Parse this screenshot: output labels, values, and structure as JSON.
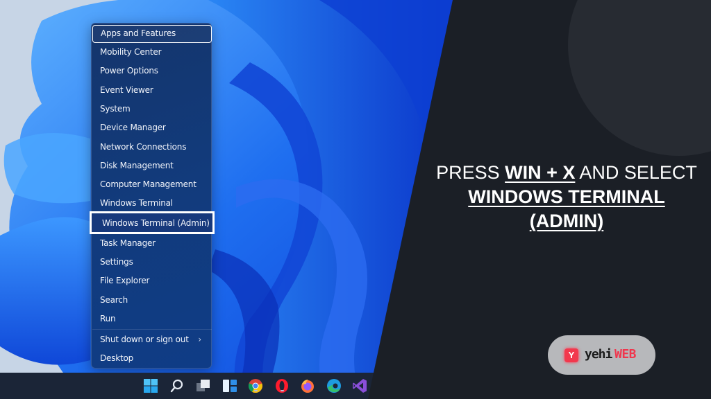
{
  "winx_menu": {
    "items": [
      {
        "label": "Apps and Features",
        "state": "focused"
      },
      {
        "label": "Mobility Center"
      },
      {
        "label": "Power Options"
      },
      {
        "label": "Event Viewer"
      },
      {
        "label": "System"
      },
      {
        "label": "Device Manager"
      },
      {
        "label": "Network Connections"
      },
      {
        "label": "Disk Management"
      },
      {
        "label": "Computer Management"
      },
      {
        "label": "Windows Terminal"
      },
      {
        "label": "Windows Terminal (Admin)",
        "state": "highlighted"
      },
      {
        "label": "Task Manager"
      },
      {
        "label": "Settings"
      },
      {
        "label": "File Explorer"
      },
      {
        "label": "Search"
      },
      {
        "label": "Run"
      },
      {
        "label": "Shut down or sign out",
        "has_submenu": true
      },
      {
        "label": "Desktop"
      }
    ],
    "submenu_chevron": "›"
  },
  "taskbar": {
    "icons": [
      {
        "name": "start-icon"
      },
      {
        "name": "search-icon"
      },
      {
        "name": "task-view-icon"
      },
      {
        "name": "widgets-icon"
      },
      {
        "name": "chrome-icon",
        "running": true
      },
      {
        "name": "opera-icon",
        "running": true
      },
      {
        "name": "firefox-icon"
      },
      {
        "name": "edge-icon"
      },
      {
        "name": "visual-studio-icon"
      }
    ]
  },
  "headline": {
    "line1_prefix": "PRESS ",
    "line1_key": "WIN + X",
    "line1_suffix": " AND SELECT",
    "line2": "WINDOWS TERMINAL",
    "line3": "(ADMIN)"
  },
  "brand": {
    "logo_glyph": "Y",
    "name_part1": "yehi",
    "name_part2": "WEB",
    "accent_color": "#f0364d"
  },
  "colors": {
    "panel_bg": "#1b1f26",
    "menu_bg": "#133a7a",
    "taskbar_bg": "#1b2537"
  }
}
